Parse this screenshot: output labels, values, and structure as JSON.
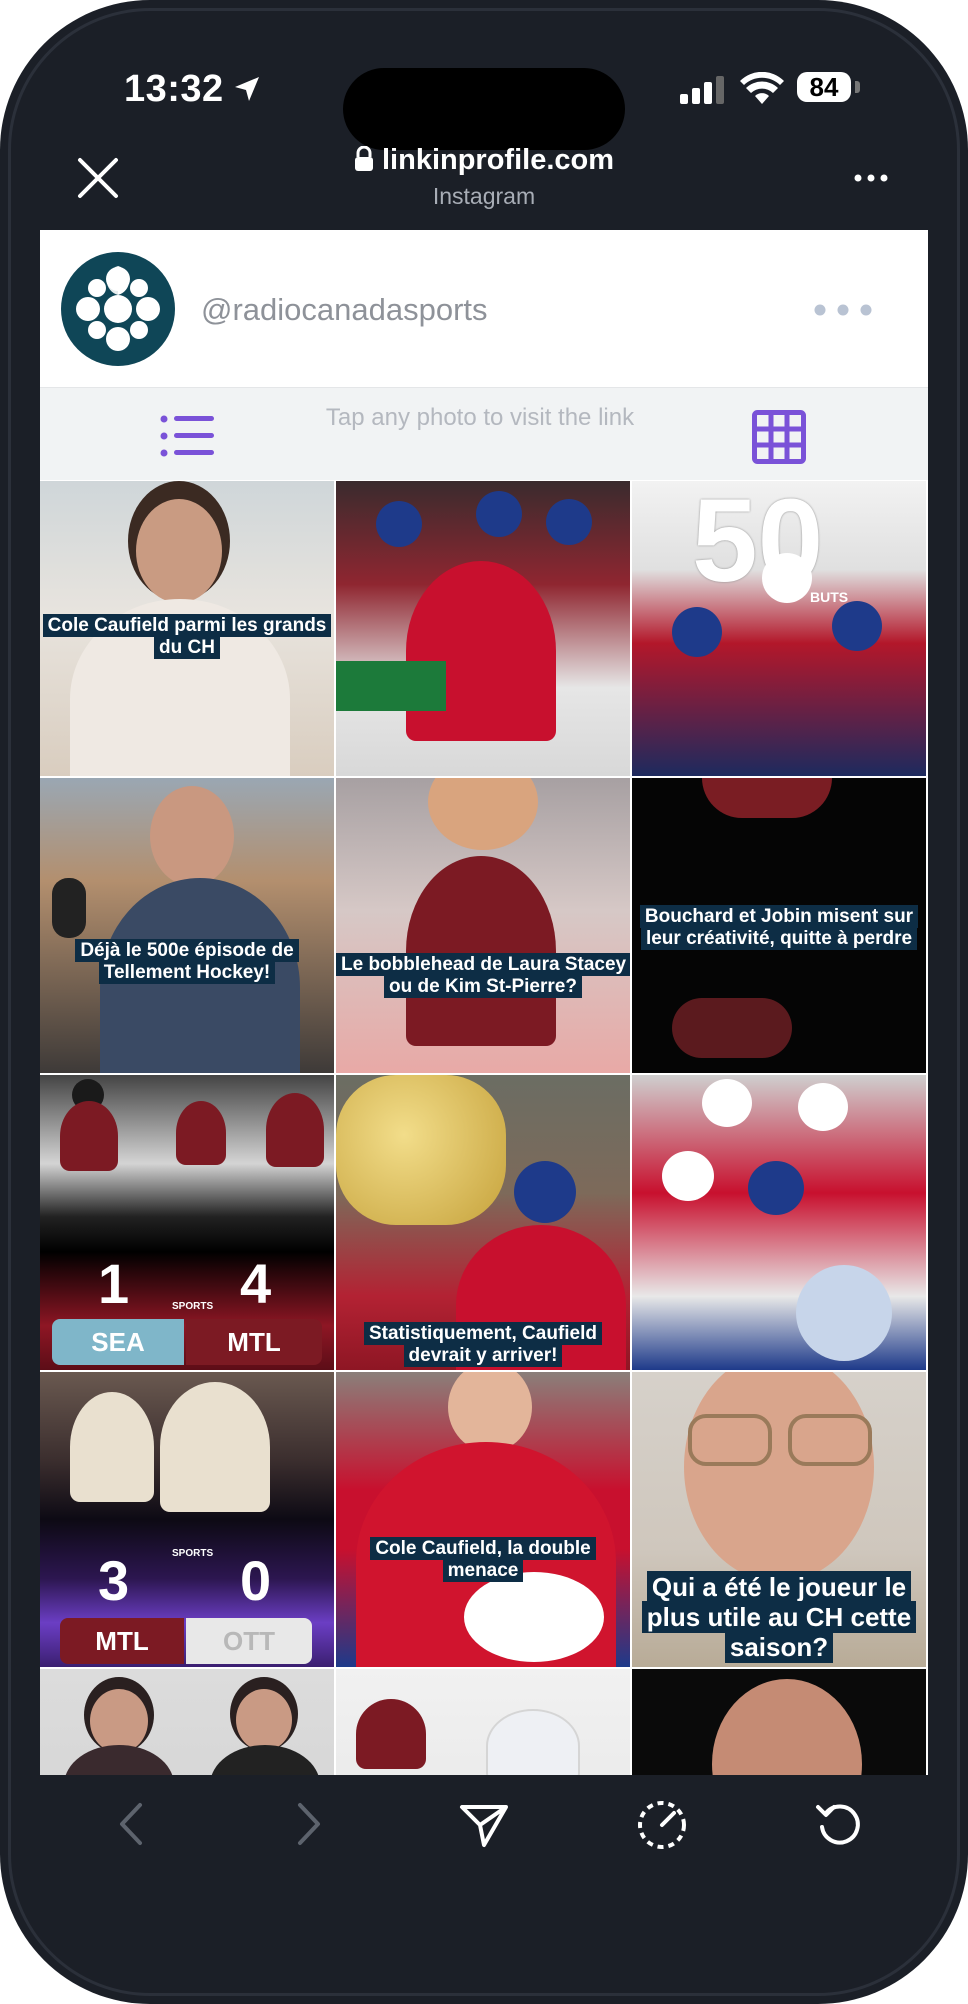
{
  "status_bar": {
    "time": "13:32",
    "battery": "84"
  },
  "browser": {
    "url": "linkinprofile.com",
    "subtitle": "Instagram"
  },
  "profile": {
    "handle": "@radiocanadasports",
    "hint": "Tap any photo to visit the link"
  },
  "colors": {
    "accent": "#7a52d8",
    "caption_bg": "#0d2d45",
    "logo_bg": "#0f4657",
    "frame": "#1b1f27"
  },
  "tiles": [
    {
      "caption": "Cole Caufield parmi les grands du CH"
    },
    {
      "caption": ""
    },
    {
      "caption": "",
      "badge_number": "50",
      "badge_word": "BUTS"
    },
    {
      "caption": "Déjà le 500e épisode de Tellement Hockey!"
    },
    {
      "caption": "Le bobblehead de Laura Stacey ou de Kim St-Pierre?"
    },
    {
      "caption": "Bouchard et Jobin misent sur leur créativité, quitte à perdre"
    },
    {
      "caption": "",
      "home_score": "1",
      "away_score": "4",
      "home_team": "SEA",
      "away_team": "MTL",
      "network": "SPORTS"
    },
    {
      "caption": "Statistiquement, Caufield devrait y arriver!"
    },
    {
      "caption": ""
    },
    {
      "caption": "",
      "home_score": "3",
      "away_score": "0",
      "home_team": "MTL",
      "away_team": "OTT",
      "network": "SPORTS"
    },
    {
      "caption": "Cole Caufield, la double menace"
    },
    {
      "caption": "Qui a été le joueur le plus utile au CH cette saison?"
    },
    {
      "caption": ""
    },
    {
      "caption": ""
    },
    {
      "caption": ""
    }
  ],
  "icons": {
    "close": "close-icon",
    "lock": "lock-icon",
    "more": "more-icon",
    "list_view": "list-view-icon",
    "grid_view": "grid-view-icon",
    "back": "back-arrow-icon",
    "forward": "forward-arrow-icon",
    "share": "send-icon",
    "speed": "speedometer-icon",
    "reload": "reload-icon"
  }
}
